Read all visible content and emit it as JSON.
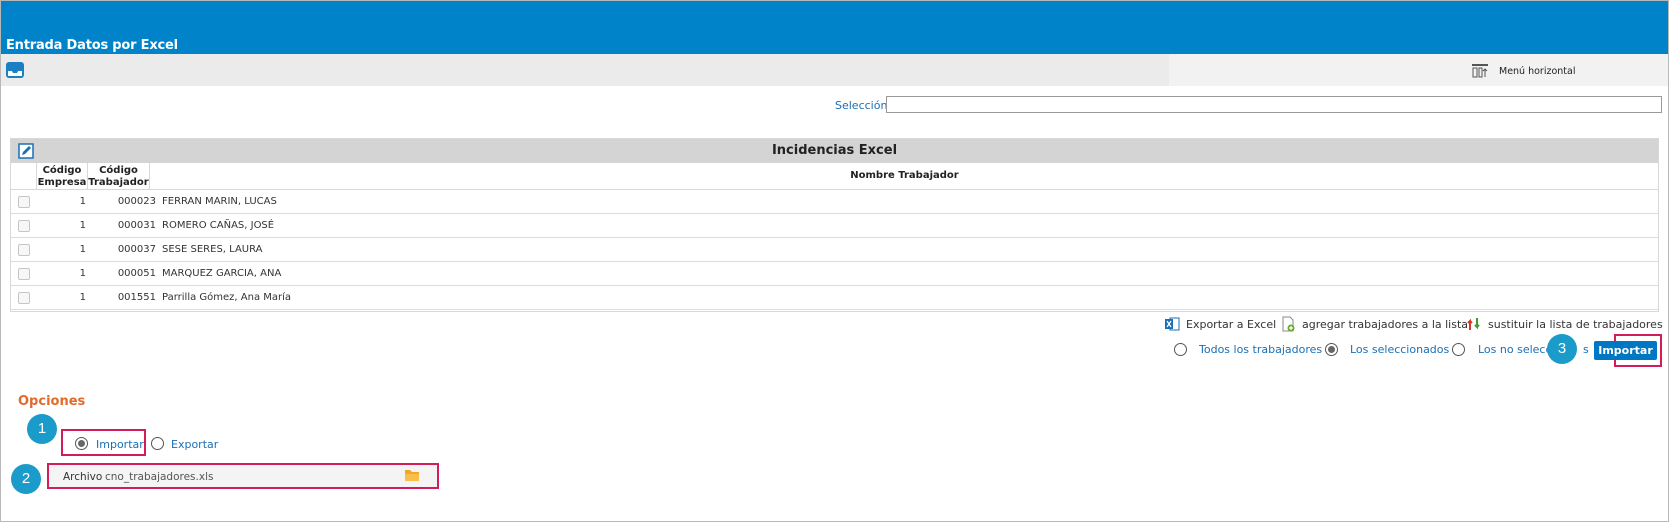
{
  "window": {
    "title": "Entrada Datos por Excel"
  },
  "toolbar": {
    "menu_horizontal_label": "Menú horizontal"
  },
  "selection": {
    "label": "Selección",
    "value": ""
  },
  "grid": {
    "title": "Incidencias Excel",
    "columns": {
      "empresa": "Código Empresa",
      "trabajador": "Código Trabajador",
      "nombre": "Nombre Trabajador"
    },
    "rows": [
      {
        "empresa": "1",
        "codigo": "000023",
        "nombre": "FERRAN MARIN, LUCAS"
      },
      {
        "empresa": "1",
        "codigo": "000031",
        "nombre": "ROMERO CAÑAS, JOSÉ"
      },
      {
        "empresa": "1",
        "codigo": "000037",
        "nombre": "SESE SERES, LAURA"
      },
      {
        "empresa": "1",
        "codigo": "000051",
        "nombre": "MARQUEZ GARCIA, ANA"
      },
      {
        "empresa": "1",
        "codigo": "001551",
        "nombre": "Parrilla Gómez, Ana María"
      }
    ]
  },
  "actions": {
    "export_excel": "Exportar a Excel",
    "add_workers": "agregar trabajadores a la lista",
    "replace_list": "sustituir la lista de trabajadores"
  },
  "filter": {
    "all": "Todos los trabajadores",
    "selected": "Los seleccionados",
    "not_selected": "Los no seleccio",
    "not_selected_tail": "s",
    "value": "selected"
  },
  "import_button": "Importar",
  "options": {
    "heading": "Opciones",
    "import_label": "Importar",
    "export_label": "Exportar",
    "mode": "import",
    "archivo_label": "Archivo",
    "archivo_value": "cno_trabajadores.xls"
  },
  "badges": [
    "1",
    "2",
    "3"
  ],
  "colors": {
    "header": "#0083c9",
    "highlight": "#d11e5a",
    "badge": "#1a9bc9",
    "options_heading": "#e46a2c"
  }
}
